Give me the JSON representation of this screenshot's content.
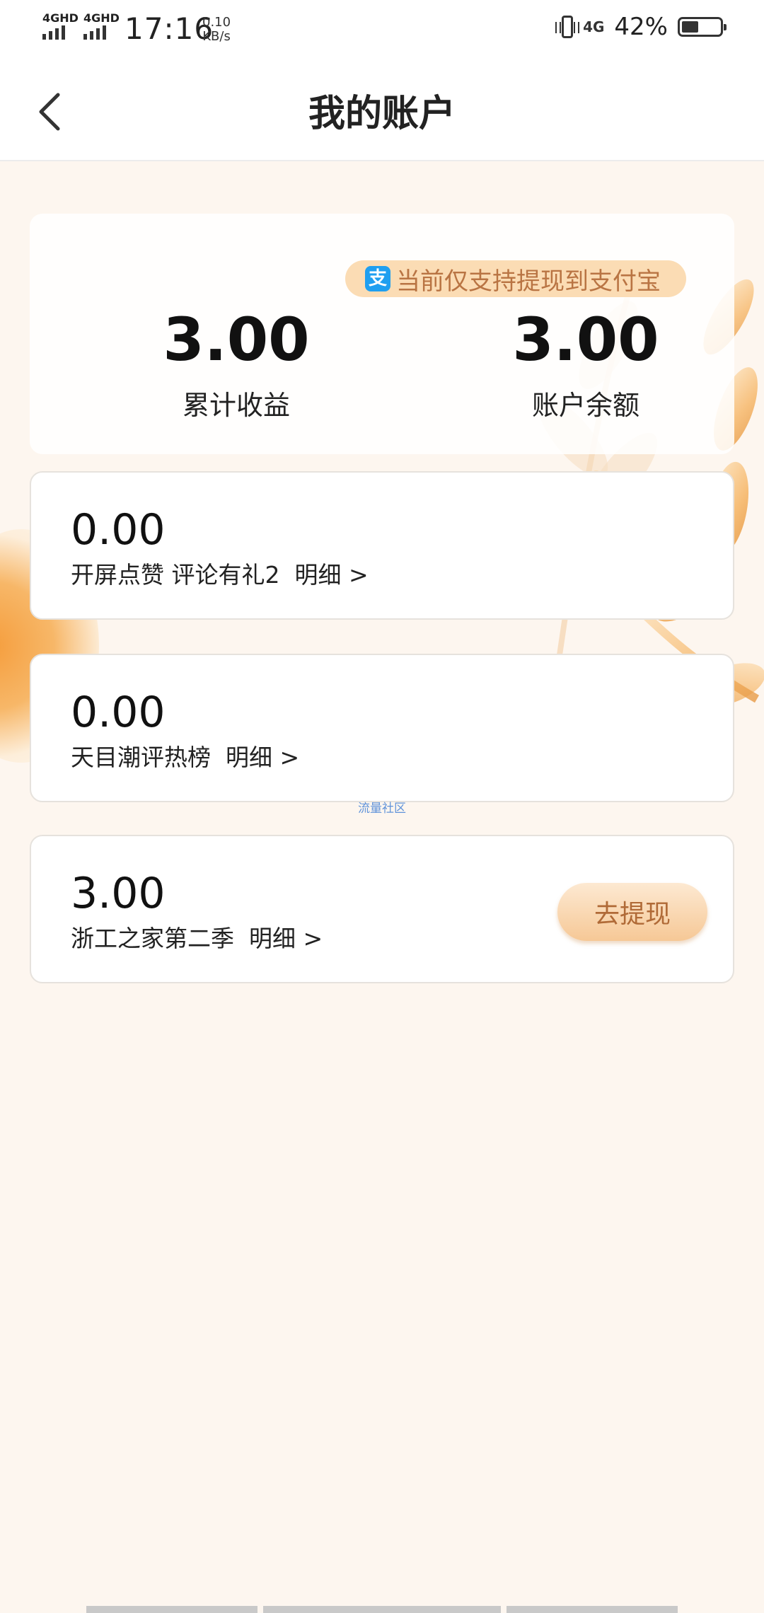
{
  "status_bar": {
    "net1": "4GHD",
    "net2": "4GHD",
    "time": "17:16",
    "speed_value": "0.10",
    "speed_unit": "KB/s",
    "net_type": "4G",
    "battery": "42%",
    "battery_level": 0.42
  },
  "header": {
    "title": "我的账户"
  },
  "summary": {
    "alipay_icon_glyph": "支",
    "tip": "当前仅支持提现到支付宝",
    "total_value": "3.00",
    "total_label": "累计收益",
    "balance_value": "3.00",
    "balance_label": "账户余额"
  },
  "programs": [
    {
      "amount": "0.00",
      "desc": "开屏点赞 评论有礼2  明细 >"
    },
    {
      "amount": "0.00",
      "desc": "天目潮评热榜  明细 >"
    },
    {
      "amount": "3.00",
      "desc": "浙工之家第二季  明细 >",
      "action": "去提现"
    }
  ],
  "watermark": "流量社区",
  "colors": {
    "accent": "#b97443",
    "tip_bg": "#fbdcb4",
    "page_bg": "#fdf6ef"
  }
}
